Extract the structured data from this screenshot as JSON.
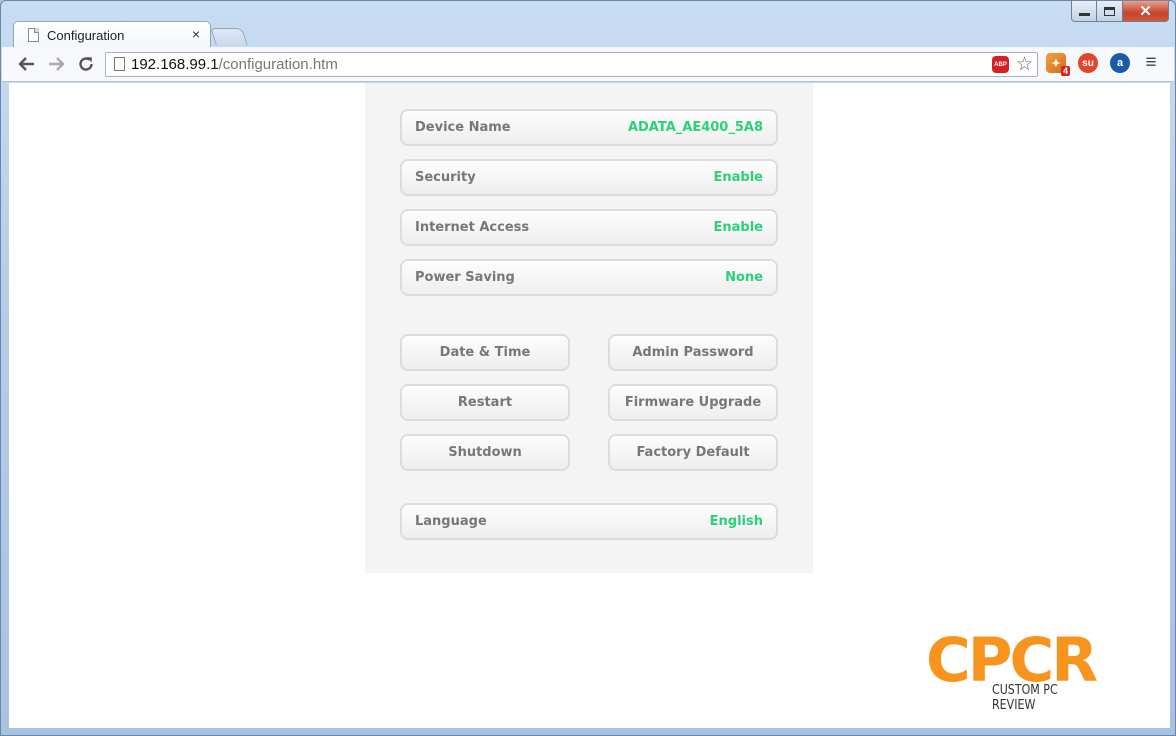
{
  "browser": {
    "tab_title": "Configuration",
    "tab_close": "×",
    "url_host": "192.168.99.1",
    "url_path": "/configuration.htm",
    "abp_label": "ABP",
    "ext_badge": "4",
    "ext_two_glyph": "su",
    "ext_three_glyph": "a",
    "window_controls": {
      "close": "✕"
    }
  },
  "settings": [
    {
      "label": "Device Name",
      "value": "ADATA_AE400_5A8"
    },
    {
      "label": "Security",
      "value": "Enable"
    },
    {
      "label": "Internet Access",
      "value": "Enable"
    },
    {
      "label": "Power Saving",
      "value": "None"
    }
  ],
  "actions": {
    "date_time": "Date & Time",
    "admin_password": "Admin Password",
    "restart": "Restart",
    "firmware_upgrade": "Firmware Upgrade",
    "shutdown": "Shutdown",
    "factory_default": "Factory Default"
  },
  "language": {
    "label": "Language",
    "value": "English"
  },
  "watermark": {
    "letters": "CPCR",
    "subtitle": "CUSTOM PC REVIEW"
  },
  "colors": {
    "value_green": "#2bd17a",
    "logo_orange": "#f7941d"
  }
}
